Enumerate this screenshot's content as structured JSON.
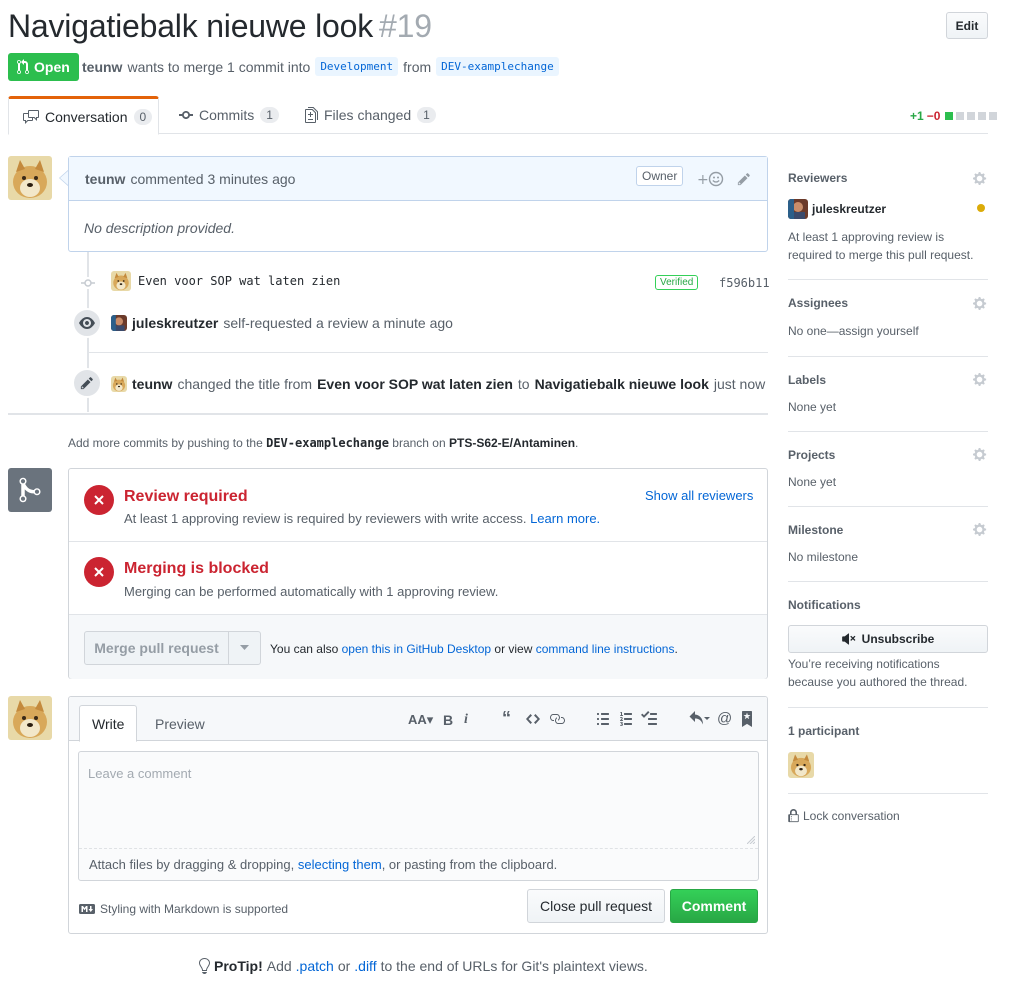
{
  "header": {
    "title": "Navigatiebalk nieuwe look",
    "number": "#19",
    "edit_label": "Edit",
    "state": "Open",
    "author": "teunw",
    "merge_text": "wants to merge 1 commit into",
    "base_branch": "Development",
    "from_text": "from",
    "head_branch": "DEV-examplechange"
  },
  "tabs": [
    {
      "label": "Conversation",
      "count": "0"
    },
    {
      "label": "Commits",
      "count": "1"
    },
    {
      "label": "Files changed",
      "count": "1"
    }
  ],
  "diffstat": {
    "additions": "+1",
    "deletions": "−0"
  },
  "comment": {
    "author": "teunw",
    "time": "commented 3 minutes ago",
    "badge": "Owner",
    "body": "No description provided."
  },
  "timeline": {
    "commit_message": "Even voor SOP wat laten zien",
    "verified": "Verified",
    "sha": "f596b11",
    "review_user": "juleskreutzer",
    "review_text": "self-requested a review a minute ago",
    "rename_user": "teunw",
    "rename_text": "changed the title from",
    "rename_from": "Even voor SOP wat laten zien",
    "rename_to_word": "to",
    "rename_to": "Navigatiebalk nieuwe look",
    "rename_time": "just now"
  },
  "push_note": {
    "prefix": "Add more commits by pushing to the",
    "branch": "DEV-examplechange",
    "middle": "branch on",
    "repo": "PTS-S62-E/Antaminen",
    "suffix": "."
  },
  "merge": {
    "review_title": "Review required",
    "review_desc": "At least 1 approving review is required by reviewers with write access.",
    "learn_more": "Learn more.",
    "show_all": "Show all reviewers",
    "blocked_title": "Merging is blocked",
    "blocked_desc": "Merging can be performed automatically with 1 approving review.",
    "merge_button": "Merge pull request",
    "alt_prefix": "You can also",
    "alt_link1": "open this in GitHub Desktop",
    "alt_middle": "or view",
    "alt_link2": "command line instructions",
    "alt_suffix": "."
  },
  "new_comment": {
    "write_tab": "Write",
    "preview_tab": "Preview",
    "placeholder": "Leave a comment",
    "attach_prefix": "Attach files by dragging & dropping,",
    "attach_link": "selecting them",
    "attach_suffix": ", or pasting from the clipboard.",
    "markdown_note": "Styling with Markdown is supported",
    "close_button": "Close pull request",
    "comment_button": "Comment"
  },
  "protip": {
    "label": "ProTip!",
    "prefix": "Add",
    "patch": ".patch",
    "or": "or",
    "diff": ".diff",
    "suffix": "to the end of URLs for Git's plaintext views."
  },
  "sidebar": {
    "reviewers_h": "Reviewers",
    "reviewer": "juleskreutzer",
    "reviewers_note": "At least 1 approving review is required to merge this pull request.",
    "assignees_h": "Assignees",
    "assignees_v": "No one—assign yourself",
    "labels_h": "Labels",
    "labels_v": "None yet",
    "projects_h": "Projects",
    "projects_v": "None yet",
    "milestone_h": "Milestone",
    "milestone_v": "No milestone",
    "notifications_h": "Notifications",
    "unsubscribe": "Unsubscribe",
    "notif_note": "You’re receiving notifications because you authored the thread.",
    "participants_h": "1 participant",
    "lock": "Lock conversation"
  },
  "colors": {
    "open_green": "#2cbe4e",
    "error_red": "#cb2431",
    "link_blue": "#0366d6",
    "tab_accent": "#e36209",
    "pending_dot": "#dbab09"
  }
}
